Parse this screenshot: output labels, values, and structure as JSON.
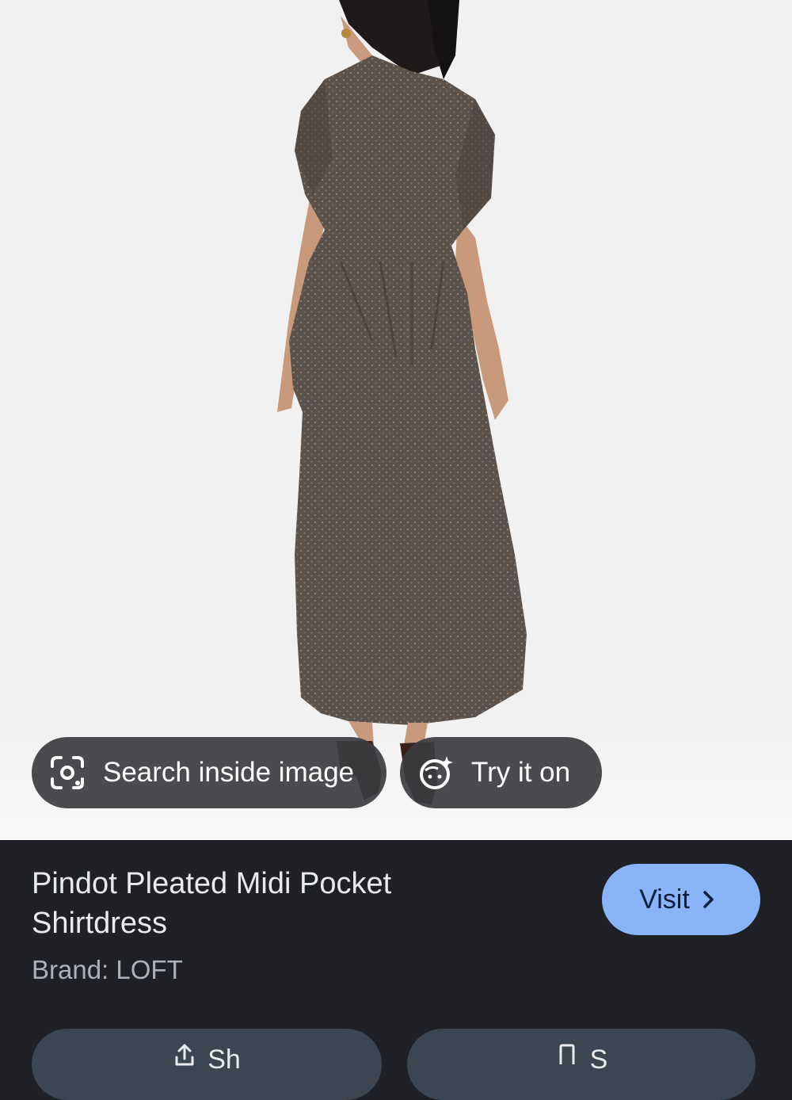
{
  "image_chips": {
    "search_label": "Search inside image",
    "try_label": "Try it on"
  },
  "product": {
    "title": "Pindot Pleated Midi Pocket Shirtdress",
    "brand": "Brand: LOFT"
  },
  "visit_button": {
    "label": "Visit"
  },
  "actions": {
    "share_label": "Sh",
    "save_label": "S"
  },
  "colors": {
    "panel_bg": "#1f2127",
    "visit_bg": "#8ab4f8",
    "chip_bg": "#3c3c40",
    "image_bg": "#f1f1f1"
  }
}
